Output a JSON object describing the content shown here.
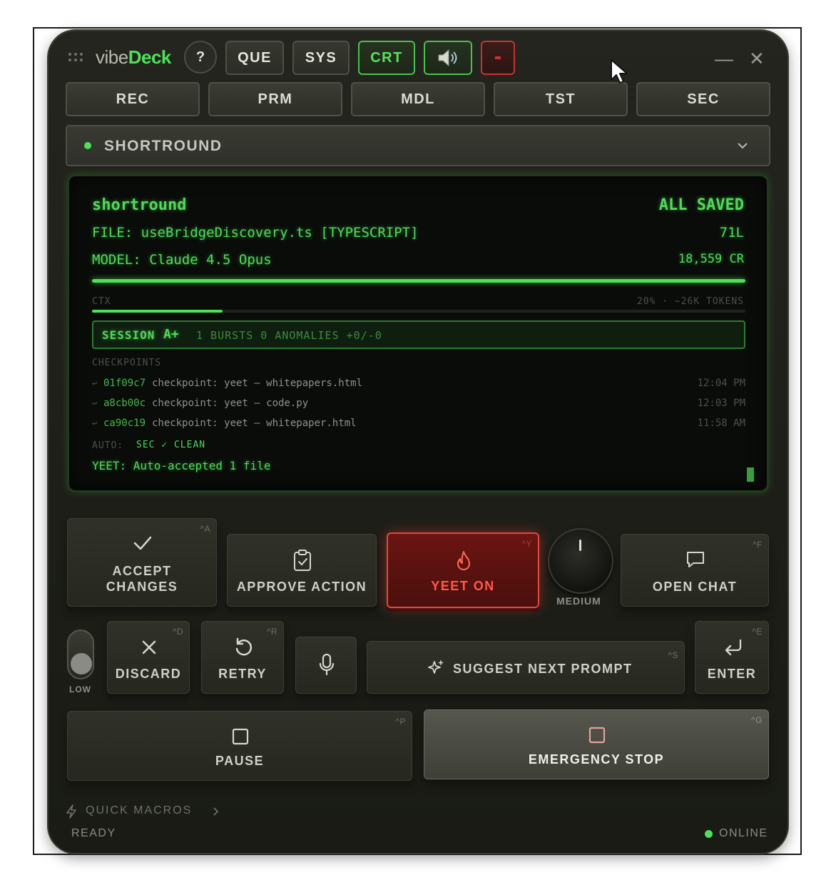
{
  "app": {
    "brand_plain": "vibe",
    "brand_accent": "Deck",
    "help_label": "?",
    "top_buttons": [
      "QUE",
      "SYS",
      "CRT"
    ],
    "speaker_icon": "speaker-icon",
    "minimize_glyph": "—",
    "close_glyph": "✕"
  },
  "nav": [
    "REC",
    "PRM",
    "MDL",
    "TST",
    "SEC"
  ],
  "project": {
    "name": "SHORTROUND",
    "status_color": "#4fe05a"
  },
  "screen": {
    "project_id": "shortround",
    "save_status": "ALL SAVED",
    "file_line": "FILE: useBridgeDiscovery.ts [TYPESCRIPT]",
    "line_count": "71L",
    "model_line": "MODEL: Claude 4.5 Opus",
    "credits": "18,559 CR",
    "ctx_label": "CTX",
    "ctx_info": "20% · ~26K TOKENS",
    "ctx_fraction": 0.2,
    "session_label": "SESSION",
    "session_grade": "A+",
    "session_stats": "1 BURSTS 0 ANOMALIES +0/-0",
    "checkpoints_label": "CHECKPOINTS",
    "checkpoints": [
      {
        "hash": "01f09c7",
        "msg": "checkpoint: yeet – whitepapers.html",
        "time": "12:04 PM"
      },
      {
        "hash": "a8cb00c",
        "msg": "checkpoint: yeet – code.py",
        "time": "12:03 PM"
      },
      {
        "hash": "ca90c19",
        "msg": "checkpoint: yeet – whitepaper.html",
        "time": "11:58 AM"
      }
    ],
    "auto_label": "AUTO:",
    "auto_value": "SEC ✓ CLEAN",
    "yeet_line": "YEET: Auto-accepted 1 file"
  },
  "controls": {
    "accept_line1": "ACCEPT",
    "accept_line2": "CHANGES",
    "accept_key": "^A",
    "approve": "APPROVE ACTION",
    "yeet": "YEET ON",
    "yeet_key": "^Y",
    "knob_label": "MEDIUM",
    "open_chat": "OPEN CHAT",
    "open_chat_key": "^F",
    "toggle_label": "LOW",
    "discard": "DISCARD",
    "discard_key": "^D",
    "retry": "RETRY",
    "retry_key": "^R",
    "suggest": "SUGGEST NEXT PROMPT",
    "suggest_key": "^S",
    "enter": "ENTER",
    "enter_key": "^E",
    "pause": "PAUSE",
    "pause_key": "^P",
    "emergency": "EMERGENCY STOP",
    "emergency_key": "^G"
  },
  "footer": {
    "macros": "QUICK MACROS",
    "ready": "READY",
    "online": "ONLINE"
  },
  "colors": {
    "accent_green": "#4fe05a",
    "danger_red": "#e04a40"
  }
}
